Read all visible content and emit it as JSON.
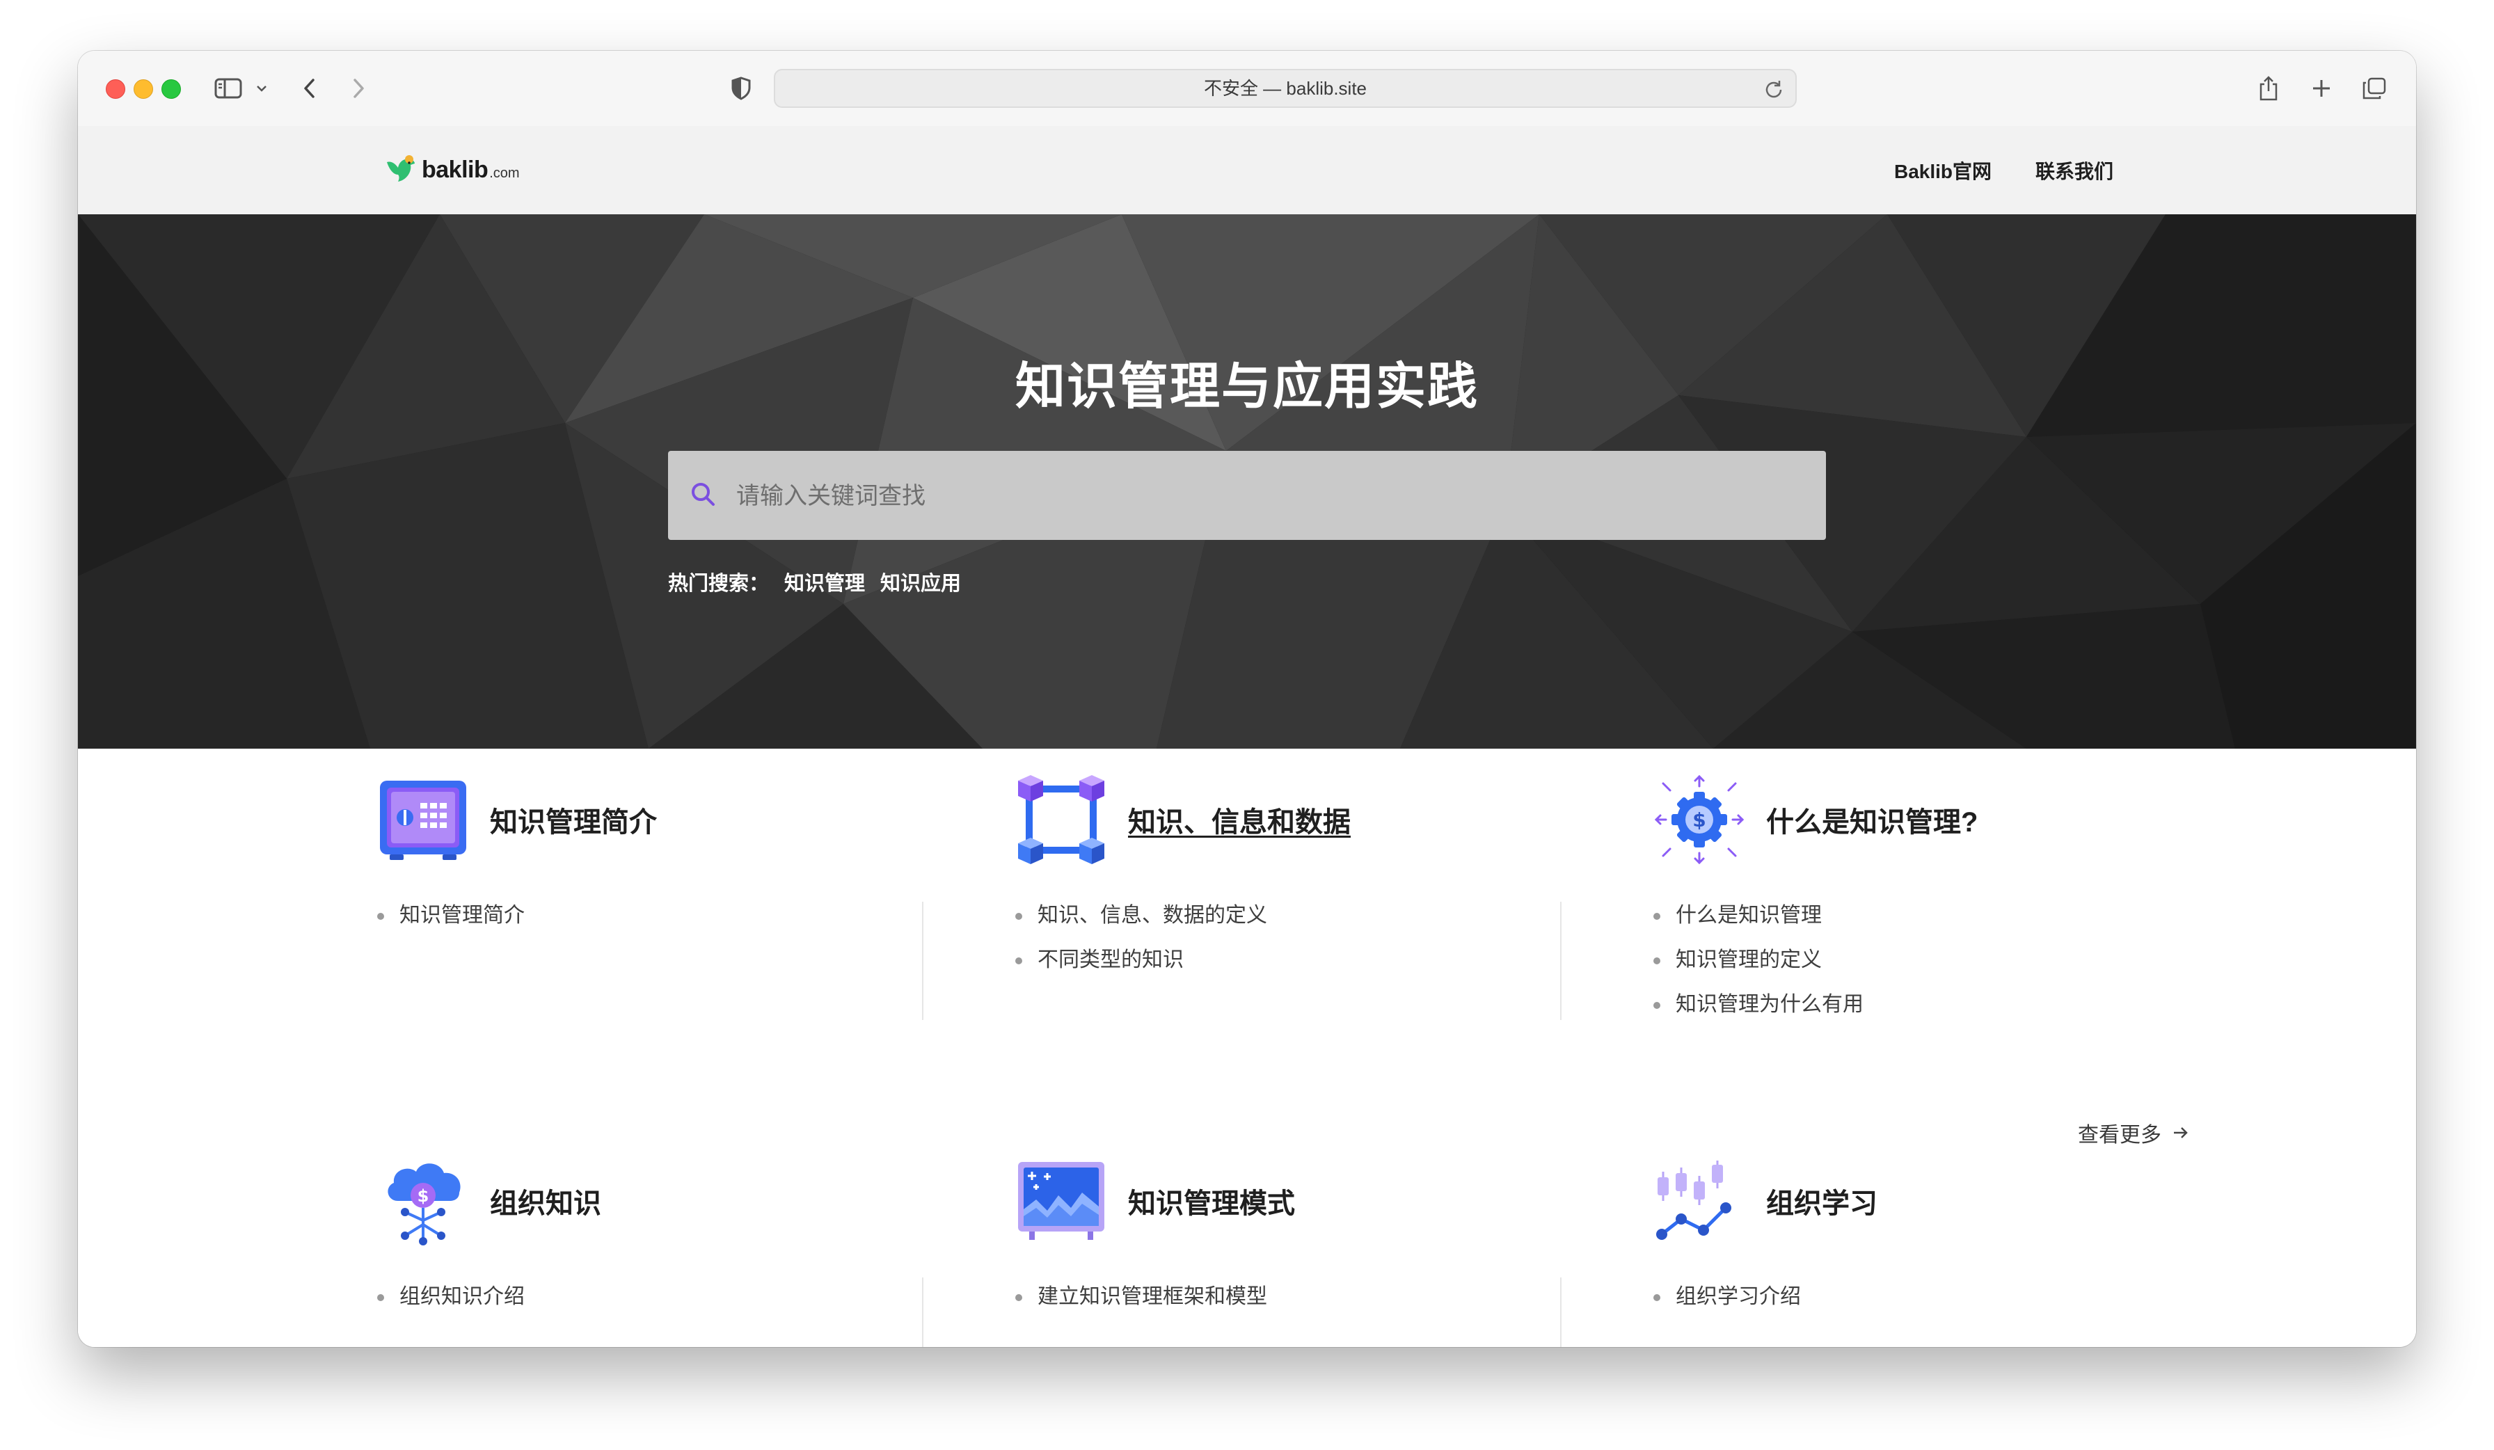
{
  "browser": {
    "url_text": "不安全 — baklib.site"
  },
  "site": {
    "logo_text": "baklib",
    "logo_suffix": ".com",
    "nav": [
      "Baklib官网",
      "联系我们"
    ]
  },
  "hero": {
    "title": "知识管理与应用实践",
    "search_placeholder": "请输入关键词查找",
    "hot_label": "热门搜索：",
    "hot_terms": [
      "知识管理",
      "知识应用"
    ]
  },
  "categories": [
    {
      "title": "知识管理简介",
      "icon": "safe-icon",
      "items": [
        "知识管理简介"
      ]
    },
    {
      "title": "知识、信息和数据",
      "icon": "cube-network-icon",
      "items": [
        "知识、信息、数据的定义",
        "不同类型的知识"
      ]
    },
    {
      "title": "什么是知识管理?",
      "icon": "gear-dollar-icon",
      "items": [
        "什么是知识管理",
        "知识管理的定义",
        "知识管理为什么有用"
      ],
      "more_label": "查看更多"
    },
    {
      "title": "组织知识",
      "icon": "cloud-dollar-icon",
      "items": [
        "组织知识介绍"
      ]
    },
    {
      "title": "知识管理模式",
      "icon": "monitor-chart-icon",
      "items": [
        "建立知识管理框架和模型"
      ]
    },
    {
      "title": "组织学习",
      "icon": "candlestick-chart-icon",
      "items": [
        "组织学习介绍"
      ]
    }
  ],
  "colors": {
    "accent": "#7b4fe0",
    "icon_blue": "#2f6bf0",
    "hero_bg": "#1c1c1c"
  }
}
